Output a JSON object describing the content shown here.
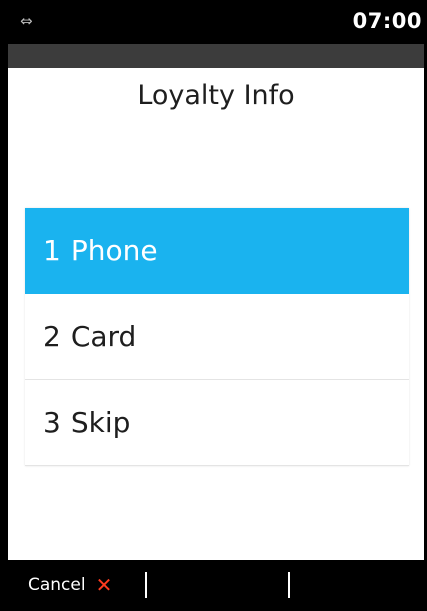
{
  "status_bar": {
    "sync_icon": "⇔",
    "time": "07:00"
  },
  "screen": {
    "title": "Loyalty Info"
  },
  "menu": {
    "items": [
      {
        "number": "1",
        "label": "Phone",
        "selected": true
      },
      {
        "number": "2",
        "label": "Card",
        "selected": false
      },
      {
        "number": "3",
        "label": "Skip",
        "selected": false
      }
    ]
  },
  "bottom_bar": {
    "cancel_label": "Cancel",
    "cancel_icon": "✕"
  },
  "colors": {
    "selected": "#1ab3ef",
    "cancel_icon": "#ff3b1f",
    "bar": "#000000"
  }
}
